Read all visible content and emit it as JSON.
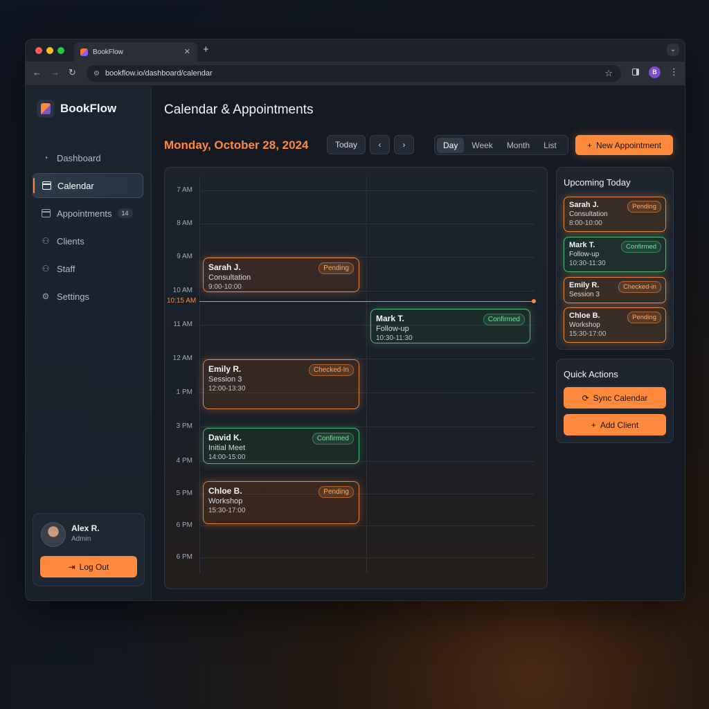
{
  "browser": {
    "tab_title": "BookFlow",
    "tab_close": "✕",
    "new_tab": "+",
    "url": "bookflow.io/dashboard/calendar",
    "profile_initial": "B"
  },
  "sidebar": {
    "brand": "BookFlow",
    "items": [
      {
        "label": "Dashboard",
        "icon": "dashboard-icon"
      },
      {
        "label": "Calendar",
        "icon": "calendar-icon"
      },
      {
        "label": "Appointments",
        "icon": "appointments-icon",
        "badge": "14"
      },
      {
        "label": "Clients",
        "icon": "clients-icon"
      },
      {
        "label": "Staff",
        "icon": "staff-icon"
      },
      {
        "label": "Settings",
        "icon": "settings-icon"
      }
    ],
    "user": {
      "name": "Alex R.",
      "role": "Admin",
      "logout_label": "Log Out"
    }
  },
  "main": {
    "title": "Calendar & Appointments",
    "date": "Monday, October 28, 2024",
    "today_label": "Today",
    "views": [
      "Day",
      "Week",
      "Month",
      "List"
    ],
    "active_view": "Day",
    "new_appointment_label": "New Appointment"
  },
  "calendar": {
    "hours": [
      "7 AM",
      "8 AM",
      "9 AM",
      "10 AM",
      "11 AM",
      "12 AM",
      "1 PM",
      "3 PM",
      "4 PM",
      "5 PM",
      "6 PM",
      "6 PM"
    ],
    "now_label": "10:15 AM",
    "appointments": [
      {
        "name": "Sarah J.",
        "type": "Consultation",
        "time": "9:00-10:00",
        "status": "Pending"
      },
      {
        "name": "Mark T.",
        "type": "Follow-up",
        "time": "10:30-11:30",
        "status": "Confirmed"
      },
      {
        "name": "Emily R.",
        "type": "Session 3",
        "time": "12:00-13:30",
        "status": "Checked-In"
      },
      {
        "name": "David K.",
        "type": "Initial Meet",
        "time": "14:00-15:00",
        "status": "Confirmed"
      },
      {
        "name": "Chloe B.",
        "type": "Workshop",
        "time": "15:30-17:00",
        "status": "Pending"
      }
    ]
  },
  "upcoming": {
    "title": "Upcoming Today",
    "items": [
      {
        "name": "Sarah J.",
        "type": "Consultation",
        "time": "8:00-10:00",
        "status": "Pending"
      },
      {
        "name": "Mark T.",
        "type": "Follow-up",
        "time": "10:30-11:30",
        "status": "Confirmed"
      },
      {
        "name": "Emily R.",
        "type": "Session 3",
        "status": "Checked-in"
      },
      {
        "name": "Chloe B.",
        "type": "Workshop",
        "time": "15:30-17:00",
        "status": "Pending"
      }
    ]
  },
  "quick_actions": {
    "title": "Quick Actions",
    "sync_label": "Sync Calendar",
    "add_client_label": "Add Client"
  },
  "colors": {
    "accent": "#ff8a3d",
    "pending": "#e8853f",
    "confirmed": "#4fbf78",
    "window_red": "#ff5f57",
    "window_yellow": "#febc2e",
    "window_green": "#28c840"
  }
}
